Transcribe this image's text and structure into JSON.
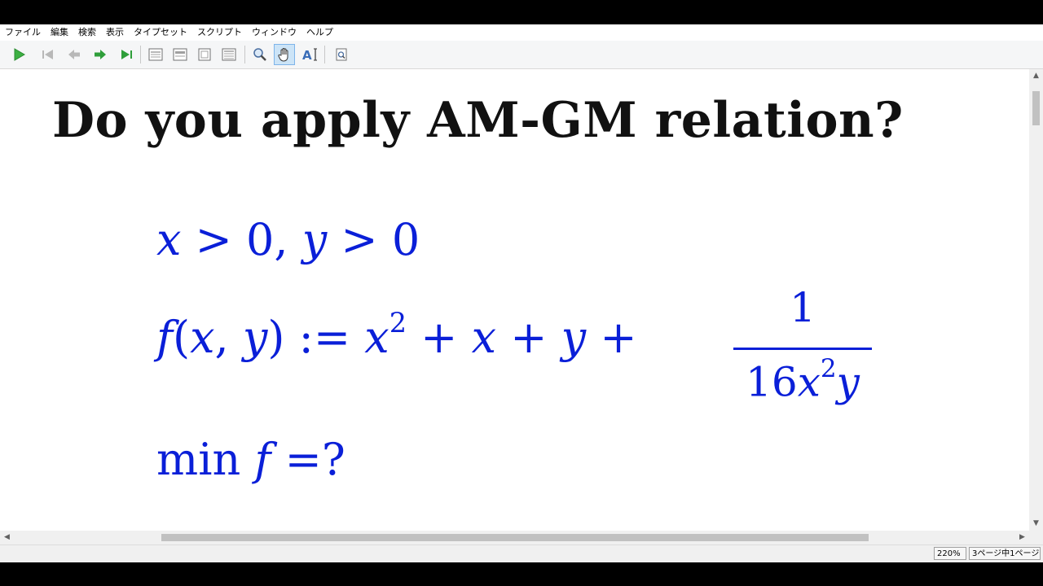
{
  "menu": {
    "items": [
      "ファイル",
      "編集",
      "検索",
      "表示",
      "タイプセット",
      "スクリプト",
      "ウィンドウ",
      "ヘルプ"
    ]
  },
  "toolbar": {
    "buttons": [
      "play-icon",
      "first-page-icon",
      "previous-page-icon",
      "next-page-icon",
      "last-page-icon",
      "single-page-icon",
      "facing-pages-icon",
      "fit-page-icon",
      "fit-width-icon",
      "magnifier-icon",
      "hand-icon",
      "select-text-icon",
      "find-icon"
    ],
    "active_tool": "hand-icon"
  },
  "document": {
    "title": "Do you apply AM-GM relation?",
    "line1": {
      "x": "x",
      "gt1": " > 0, ",
      "y": "y",
      "gt2": " > 0"
    },
    "line2": {
      "f": "f",
      "open": "(",
      "x1": "x",
      "comma": ", ",
      "y1": "y",
      "close": ") := ",
      "x2": "x",
      "exp": "2",
      "plus1": " + ",
      "x3": "x",
      "plus2": " + ",
      "y2": "y",
      "plus3": " + "
    },
    "fraction": {
      "numerator": "1",
      "den_coeff": "16",
      "den_x": "x",
      "den_exp": "2",
      "den_y": "y"
    },
    "line3": {
      "min": "min ",
      "f": "f",
      "rest": " =?"
    }
  },
  "status": {
    "zoom": "220%",
    "page": "3ページ中1ページ"
  },
  "colors": {
    "math": "#0a1fd8",
    "title": "#111111",
    "toolbar_accent": "#cce4f7"
  }
}
